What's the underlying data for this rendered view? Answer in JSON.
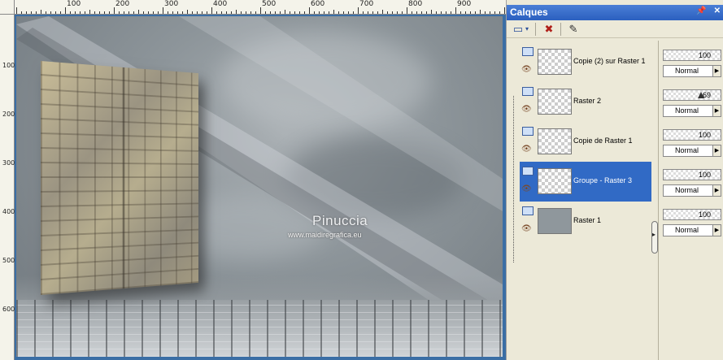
{
  "ruler": {
    "top_labels": [
      "100",
      "200",
      "300",
      "400",
      "500",
      "600",
      "700",
      "800",
      "900"
    ],
    "left_labels": [
      "100",
      "200",
      "300",
      "400",
      "500",
      "600"
    ]
  },
  "canvas": {
    "watermark_title": "Pinuccia",
    "watermark_url": "www.maidiregrafica.eu"
  },
  "panel": {
    "title": "Calques",
    "title_buttons": [
      "pin-icon",
      "close-icon"
    ],
    "toolbar_icons": [
      "new-layer-icon",
      "dropdown-arrow-icon",
      "delete-layer-icon",
      "edit-mask-icon"
    ]
  },
  "layers": [
    {
      "name": "Copie (2) sur Raster 1",
      "opacity": "100",
      "blend": "Normal",
      "selected": false
    },
    {
      "name": "Raster 2",
      "opacity": "69",
      "blend": "Normal",
      "selected": false
    },
    {
      "name": "Copie de Raster 1",
      "opacity": "100",
      "blend": "Normal",
      "selected": false
    },
    {
      "name": "Groupe - Raster 3",
      "opacity": "100",
      "blend": "Normal",
      "selected": true
    },
    {
      "name": "Raster 1",
      "opacity": "100",
      "blend": "Normal",
      "selected": false
    }
  ],
  "colors": {
    "selection": "#316ac5",
    "title_bar": "#2b5fbf",
    "panel_bg": "#ece9d8"
  }
}
